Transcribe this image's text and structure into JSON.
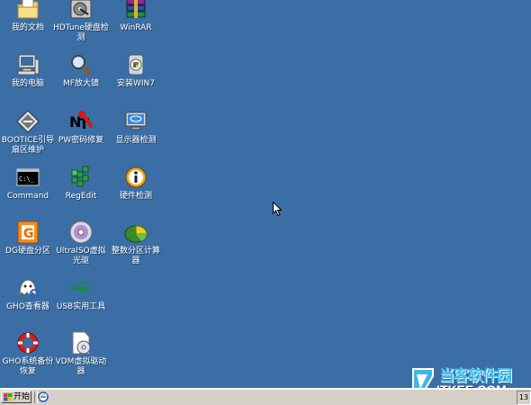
{
  "desktop_icons": [
    {
      "label": "我的文档",
      "icon": "my-documents-icon"
    },
    {
      "label": "HDTune硬盘检测",
      "icon": "hdtune-icon"
    },
    {
      "label": "WinRAR",
      "icon": "winrar-icon"
    },
    {
      "label": "我的电脑",
      "icon": "my-computer-icon"
    },
    {
      "label": "MF放大镜",
      "icon": "magnifier-icon"
    },
    {
      "label": "安装WIN7",
      "icon": "install-win7-icon"
    },
    {
      "label": "BOOTICE引导扇区维护",
      "icon": "bootice-icon"
    },
    {
      "label": "PW密码修复",
      "icon": "password-repair-icon"
    },
    {
      "label": "显示器检测",
      "icon": "monitor-test-icon"
    },
    {
      "label": "Command",
      "icon": "command-prompt-icon"
    },
    {
      "label": "RegEdit",
      "icon": "regedit-icon"
    },
    {
      "label": "硬件检测",
      "icon": "hardware-info-icon"
    },
    {
      "label": "DG硬盘分区",
      "icon": "diskgenius-icon"
    },
    {
      "label": "UltraISO虚拟光驱",
      "icon": "ultraiso-icon"
    },
    {
      "label": "整数分区计算器",
      "icon": "partition-calculator-icon"
    },
    {
      "label": "GHO查看器",
      "icon": "gho-viewer-icon"
    },
    {
      "label": "USB实用工具",
      "icon": "usb-tools-icon"
    },
    {
      "label": "GHO系统备份恢复",
      "icon": "ghost-backup-icon"
    },
    {
      "label": "VDM虚拟驱动器",
      "icon": "vdm-drive-icon"
    }
  ],
  "taskbar": {
    "start_label": "开始",
    "tray_clock": "13"
  },
  "watermark": {
    "line1": "当客软件园",
    "line2": "ITKEE.COM"
  },
  "colors": {
    "desktop": "#3a6ea5",
    "taskbar": "#d4d0c8"
  }
}
